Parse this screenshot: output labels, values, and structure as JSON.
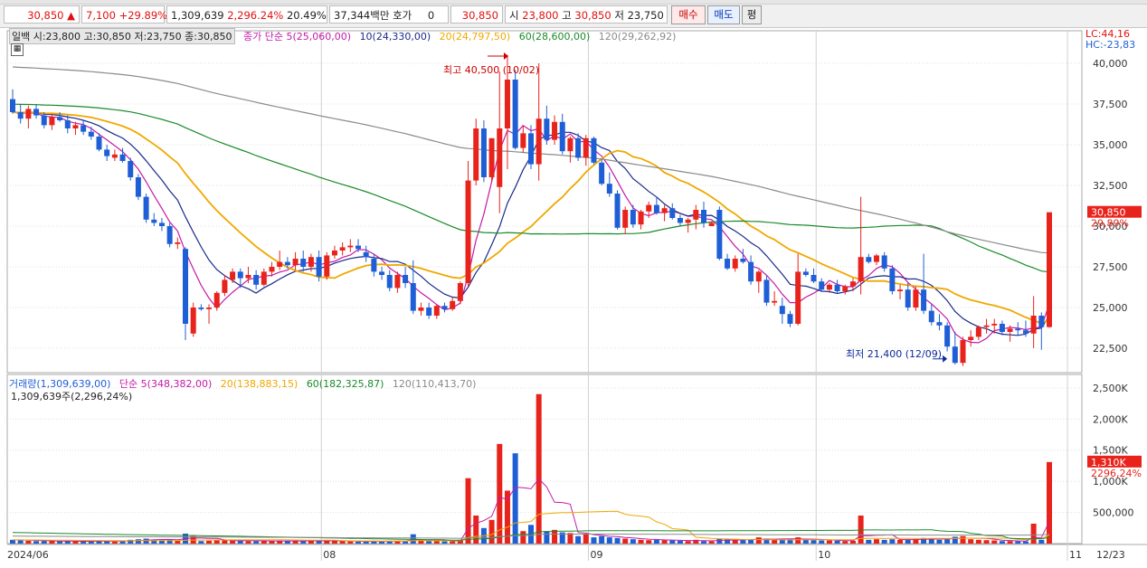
{
  "header": {
    "price": "30,850",
    "change_arrow": "▲",
    "change": "7,100",
    "change_rate": "+29.89%",
    "volume": "1,309,639",
    "volume_rate": "2,296.24%",
    "turnover_rate": "20.49%",
    "trade_value": "37,344백만",
    "quote_label": "호가",
    "quote_value": "0",
    "current": "30,850",
    "open_label": "시",
    "open": "23,800",
    "high_label": "고",
    "high": "30,850",
    "low_label": "저",
    "low": "23,750",
    "buy_button": "매수",
    "sell_button": "매도",
    "eval_button": "평"
  },
  "price_panel": {
    "ohlc_text": "일백 시:23,800 고:30,850 저:23,750 종:30,850",
    "ma_label": "종가 단순",
    "ma5": "5(25,060,00)",
    "ma10": "10(24,330,00)",
    "ma20": "20(24,797,50)",
    "ma60": "60(28,600,00)",
    "ma120": "120(29,262,92)",
    "lc": "LC:44,16",
    "hc": "HC:-23,83",
    "high_note": "최고 40,500 (10/02)",
    "low_note": "최저 21,400 (12/09)",
    "current_tag": "30,850",
    "current_rate_tag": "29,89%"
  },
  "volume_panel": {
    "vol_label": "거래량(1,309,639,00)",
    "ma_label": "단순",
    "vma5": "5(348,382,00)",
    "vma20": "20(138,883,15)",
    "vma60": "60(182,325,87)",
    "vma120": "120(110,413,70)",
    "sub_text": "1,309,639주(2,296,24%)",
    "current_tag": "1,310K",
    "current_rate_tag": "2296,24%"
  },
  "colors": {
    "up": "#e8231b",
    "down": "#1f5fd6",
    "ma5": "#c41aa8",
    "ma10": "#1a2a8a",
    "ma20": "#f0a800",
    "ma60": "#1a8a2a",
    "ma120": "#8a8a8a"
  },
  "chart_data": {
    "type": "candlestick",
    "title": "",
    "x_labels": [
      "2024/06",
      "08",
      "09",
      "10",
      "11",
      "12",
      "12/23"
    ],
    "price_axis": {
      "ticks": [
        22500,
        25000,
        27500,
        30000,
        32500,
        35000,
        37500,
        40000
      ],
      "labels": [
        "22,500",
        "25,000",
        "27,500",
        "30,000",
        "32,500",
        "35,000",
        "37,500",
        "40,000"
      ],
      "range": [
        21000,
        42000
      ]
    },
    "volume_axis": {
      "ticks": [
        500000,
        1000000,
        1500000,
        2000000,
        2500000
      ],
      "labels": [
        "500,000",
        "1,000K",
        "1,500K",
        "2,000K",
        "2,500K"
      ],
      "range": [
        0,
        2600000
      ]
    },
    "candles": [
      [
        37800,
        38400,
        36900,
        37000,
        60000
      ],
      [
        37000,
        37500,
        36300,
        36600,
        50000
      ],
      [
        36600,
        37400,
        36000,
        37200,
        45000
      ],
      [
        37200,
        37500,
        36600,
        36800,
        40000
      ],
      [
        36800,
        37000,
        36000,
        36200,
        42000
      ],
      [
        36200,
        36900,
        35900,
        36700,
        38000
      ],
      [
        36700,
        37000,
        36400,
        36500,
        35000
      ],
      [
        36500,
        36800,
        35700,
        36000,
        40000
      ],
      [
        36000,
        36400,
        35600,
        36200,
        35000
      ],
      [
        36200,
        36500,
        35600,
        35800,
        30000
      ],
      [
        35800,
        36100,
        35300,
        35500,
        38000
      ],
      [
        35500,
        35700,
        34600,
        34700,
        50000
      ],
      [
        34700,
        35000,
        34000,
        34300,
        40000
      ],
      [
        34200,
        34700,
        34000,
        34400,
        30000
      ],
      [
        34400,
        34800,
        33900,
        34000,
        35000
      ],
      [
        34000,
        34200,
        32800,
        33000,
        60000
      ],
      [
        33000,
        33200,
        31600,
        31800,
        70000
      ],
      [
        31800,
        32000,
        30200,
        30400,
        80000
      ],
      [
        30400,
        30800,
        30000,
        30200,
        60000
      ],
      [
        30200,
        30500,
        29700,
        30000,
        55000
      ],
      [
        30000,
        30200,
        28700,
        28900,
        70000
      ],
      [
        28900,
        29300,
        28600,
        29000,
        50000
      ],
      [
        28600,
        28700,
        23000,
        24000,
        160000
      ],
      [
        23400,
        25300,
        23200,
        25000,
        120000
      ],
      [
        25000,
        25200,
        24800,
        24900,
        40000
      ],
      [
        24900,
        25200,
        24000,
        25000,
        45000
      ],
      [
        25000,
        26000,
        24800,
        25900,
        50000
      ],
      [
        25900,
        27000,
        25700,
        26700,
        55000
      ],
      [
        26700,
        27400,
        26500,
        27200,
        50000
      ],
      [
        27200,
        27400,
        26200,
        26800,
        45000
      ],
      [
        26800,
        27500,
        26500,
        27000,
        40000
      ],
      [
        27000,
        27300,
        26100,
        26400,
        40000
      ],
      [
        26400,
        27400,
        26300,
        27200,
        40000
      ],
      [
        27200,
        27800,
        26900,
        27500,
        42000
      ],
      [
        27500,
        28500,
        27300,
        27800,
        45000
      ],
      [
        27800,
        28100,
        27400,
        27600,
        40000
      ],
      [
        27600,
        28400,
        27300,
        28000,
        45000
      ],
      [
        28000,
        28500,
        27200,
        27500,
        40000
      ],
      [
        27500,
        28300,
        27200,
        28100,
        45000
      ],
      [
        28100,
        28500,
        26600,
        26900,
        50000
      ],
      [
        26900,
        28400,
        26700,
        28200,
        45000
      ],
      [
        28200,
        28800,
        28000,
        28500,
        40000
      ],
      [
        28500,
        29000,
        28200,
        28700,
        40000
      ],
      [
        28700,
        29200,
        28400,
        28800,
        35000
      ],
      [
        28800,
        29200,
        28400,
        28600,
        30000
      ],
      [
        28400,
        28800,
        27800,
        28100,
        35000
      ],
      [
        28000,
        28300,
        26900,
        27200,
        40000
      ],
      [
        27200,
        27500,
        26700,
        27000,
        35000
      ],
      [
        27000,
        27300,
        26000,
        26200,
        45000
      ],
      [
        26200,
        27200,
        25900,
        27000,
        40000
      ],
      [
        27000,
        27500,
        26200,
        26500,
        35000
      ],
      [
        26500,
        27900,
        24600,
        24800,
        150000
      ],
      [
        24800,
        25300,
        24500,
        25000,
        45000
      ],
      [
        25000,
        25300,
        24300,
        24500,
        40000
      ],
      [
        24500,
        25200,
        24300,
        25100,
        40000
      ],
      [
        25100,
        25300,
        24700,
        24900,
        35000
      ],
      [
        24900,
        25600,
        24800,
        25400,
        35000
      ],
      [
        25400,
        26600,
        25200,
        26500,
        60000
      ],
      [
        26500,
        34000,
        26300,
        32800,
        1050000
      ],
      [
        32800,
        36600,
        32500,
        36000,
        450000
      ],
      [
        36000,
        36500,
        32700,
        33000,
        250000
      ],
      [
        33000,
        35400,
        32700,
        35400,
        380000
      ],
      [
        32400,
        39500,
        30800,
        36000,
        1600000
      ],
      [
        36000,
        40500,
        33500,
        39000,
        850000
      ],
      [
        39000,
        39600,
        34700,
        34800,
        1450000
      ],
      [
        34800,
        36200,
        34500,
        35700,
        200000
      ],
      [
        35700,
        36200,
        33500,
        33800,
        300000
      ],
      [
        33800,
        40000,
        32800,
        36600,
        2400000
      ],
      [
        36600,
        37400,
        35000,
        35300,
        200000
      ],
      [
        35300,
        36800,
        35000,
        36400,
        220000
      ],
      [
        36400,
        36900,
        34400,
        34600,
        180000
      ],
      [
        34600,
        35500,
        33900,
        35400,
        170000
      ],
      [
        35400,
        35700,
        34000,
        34200,
        120000
      ],
      [
        34200,
        35600,
        33700,
        35400,
        150000
      ],
      [
        35400,
        35500,
        33800,
        33900,
        100000
      ],
      [
        33900,
        34100,
        32500,
        32600,
        120000
      ],
      [
        32600,
        33300,
        31800,
        32000,
        100000
      ],
      [
        32000,
        32200,
        29800,
        29900,
        90000
      ],
      [
        29900,
        31200,
        29500,
        31000,
        80000
      ],
      [
        31000,
        31300,
        29900,
        30100,
        70000
      ],
      [
        30100,
        31000,
        29800,
        30900,
        60000
      ],
      [
        30900,
        31500,
        30500,
        31300,
        55000
      ],
      [
        31300,
        31800,
        30700,
        30800,
        60000
      ],
      [
        30800,
        31300,
        30300,
        31100,
        55000
      ],
      [
        31100,
        31400,
        30400,
        30500,
        50000
      ],
      [
        30500,
        30700,
        30000,
        30200,
        45000
      ],
      [
        30200,
        30500,
        29600,
        30400,
        40000
      ],
      [
        30400,
        31300,
        29800,
        31000,
        60000
      ],
      [
        31000,
        31500,
        29900,
        30200,
        40000
      ],
      [
        30000,
        30300,
        30000,
        30200,
        35000
      ],
      [
        31000,
        31200,
        27900,
        28000,
        80000
      ],
      [
        28000,
        28300,
        27300,
        27400,
        70000
      ],
      [
        27400,
        28200,
        27200,
        28000,
        60000
      ],
      [
        28000,
        28600,
        27700,
        27800,
        55000
      ],
      [
        27800,
        28200,
        26400,
        26600,
        60000
      ],
      [
        26600,
        27300,
        25900,
        27200,
        100000
      ],
      [
        26700,
        27000,
        25100,
        25300,
        80000
      ],
      [
        25300,
        26000,
        25100,
        25400,
        60000
      ],
      [
        25100,
        25600,
        24000,
        24600,
        70000
      ],
      [
        24600,
        24800,
        23800,
        24000,
        70000
      ],
      [
        24000,
        28300,
        23900,
        27200,
        100000
      ],
      [
        27200,
        27400,
        26900,
        27000,
        60000
      ],
      [
        27000,
        27400,
        26500,
        26600,
        55000
      ],
      [
        26600,
        26800,
        26000,
        26100,
        50000
      ],
      [
        26100,
        26500,
        25900,
        26400,
        50000
      ],
      [
        26400,
        26700,
        25900,
        26000,
        45000
      ],
      [
        26000,
        26400,
        25800,
        26300,
        40000
      ],
      [
        26300,
        26800,
        26000,
        26600,
        45000
      ],
      [
        26600,
        31800,
        25800,
        28100,
        450000
      ],
      [
        28100,
        28300,
        27700,
        27800,
        60000
      ],
      [
        27800,
        28300,
        27600,
        28200,
        70000
      ],
      [
        28200,
        28400,
        27200,
        27400,
        60000
      ],
      [
        27400,
        27600,
        25800,
        26000,
        70000
      ],
      [
        26000,
        26400,
        25500,
        26100,
        60000
      ],
      [
        26100,
        26500,
        24800,
        25000,
        60000
      ],
      [
        25000,
        26300,
        24800,
        26100,
        70000
      ],
      [
        26100,
        28300,
        24600,
        24800,
        90000
      ],
      [
        24800,
        25200,
        23900,
        24100,
        80000
      ],
      [
        24100,
        24600,
        23600,
        23900,
        60000
      ],
      [
        23900,
        24100,
        22300,
        22600,
        70000
      ],
      [
        22600,
        23500,
        21500,
        21600,
        110000
      ],
      [
        21600,
        23200,
        21400,
        23000,
        120000
      ],
      [
        23000,
        23600,
        22600,
        23200,
        70000
      ],
      [
        23200,
        23900,
        23000,
        23800,
        60000
      ],
      [
        23800,
        24300,
        23400,
        23900,
        55000
      ],
      [
        23900,
        24300,
        23400,
        24000,
        50000
      ],
      [
        24000,
        24200,
        23300,
        23500,
        40000
      ],
      [
        23500,
        23900,
        22900,
        23700,
        40000
      ],
      [
        23700,
        24100,
        23300,
        23600,
        35000
      ],
      [
        23600,
        24200,
        23200,
        23400,
        35000
      ],
      [
        23400,
        25700,
        22500,
        24500,
        320000
      ],
      [
        24500,
        24700,
        22400,
        23800,
        60000
      ],
      [
        23800,
        30850,
        23750,
        30850,
        1309639
      ]
    ],
    "ma_series": [
      "ma5",
      "ma10",
      "ma20",
      "ma60",
      "ma120"
    ]
  }
}
